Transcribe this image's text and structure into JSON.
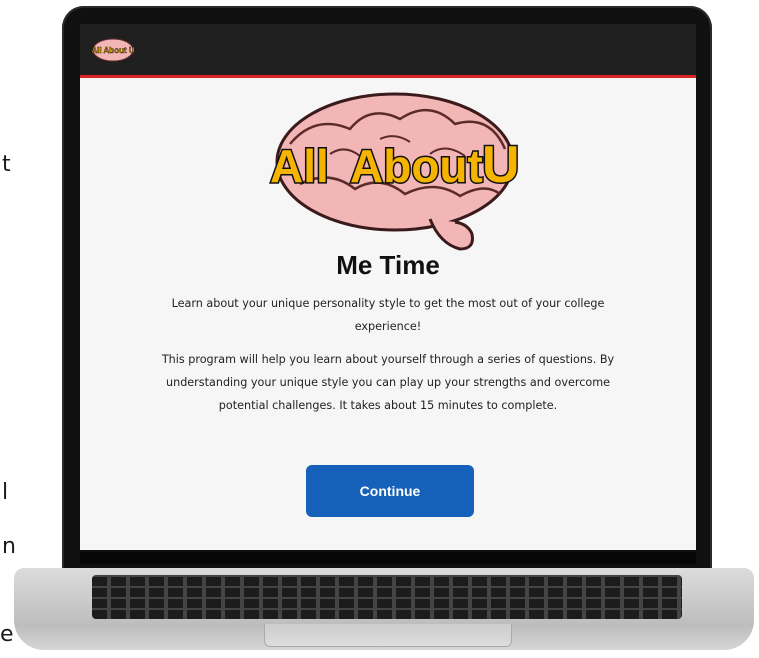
{
  "side_fragments": [
    "t",
    "l",
    "n",
    "e"
  ],
  "header": {
    "mini_logo_text": "All About U"
  },
  "logo": {
    "word1": "All",
    "word2": "About",
    "word3": "U"
  },
  "main": {
    "title": "Me Time",
    "paragraph1": "Learn about your unique personality style to get the most out of your college experience!",
    "paragraph2": "This program will help you learn about yourself through a series of questions. By understanding your unique style you can play up your strengths and overcome potential challenges. It takes about 15 minutes to complete.",
    "continue_label": "Continue"
  },
  "colors": {
    "topbar": "#202020",
    "topbar_border": "#d92424",
    "button": "#1560b8",
    "logo_text": "#f4b400",
    "brain": "#f3b6b6"
  }
}
